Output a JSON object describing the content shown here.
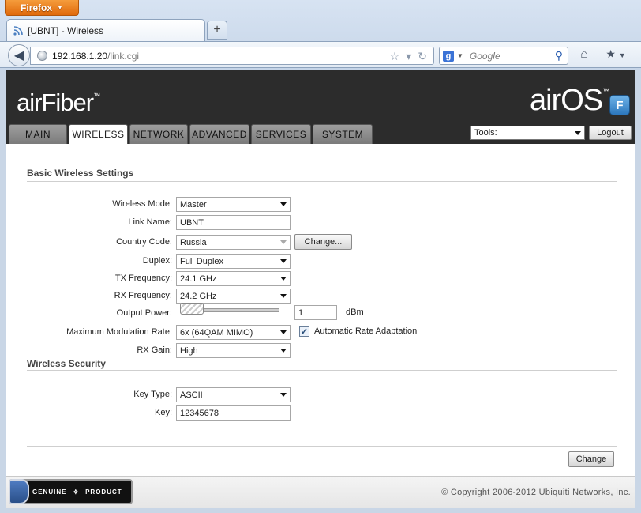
{
  "browser": {
    "menu_button": "Firefox",
    "tab_title": "[UBNT] - Wireless",
    "new_tab": "+",
    "url_host": "192.168.1.20",
    "url_path": "/link.cgi",
    "search_placeholder": "Google",
    "search_engine": "g"
  },
  "header": {
    "brand_logo": "airFiber",
    "product_logo": "airOS",
    "product_badge": "F",
    "tabs": [
      "MAIN",
      "WIRELESS",
      "NETWORK",
      "ADVANCED",
      "SERVICES",
      "SYSTEM"
    ],
    "active_tab": "WIRELESS",
    "tools_label": "Tools:",
    "logout_label": "Logout"
  },
  "basic": {
    "title": "Basic Wireless Settings",
    "wireless_mode_label": "Wireless Mode:",
    "wireless_mode": "Master",
    "link_name_label": "Link Name:",
    "link_name": "UBNT",
    "country_label": "Country Code:",
    "country": "Russia",
    "change_country": "Change...",
    "duplex_label": "Duplex:",
    "duplex": "Full Duplex",
    "tx_label": "TX Frequency:",
    "tx": "24.1 GHz",
    "rx_label": "RX Frequency:",
    "rx": "24.2 GHz",
    "power_label": "Output Power:",
    "power_value": "1",
    "power_unit": "dBm",
    "power_level": 0.0,
    "modulation_label": "Maximum Modulation Rate:",
    "modulation": "6x (64QAM MIMO)",
    "auto_rate_checked": true,
    "auto_rate_label": "Automatic Rate Adaptation",
    "rx_gain_label": "RX Gain:",
    "rx_gain": "High"
  },
  "security": {
    "title": "Wireless Security",
    "key_type_label": "Key Type:",
    "key_type": "ASCII",
    "key_label": "Key:",
    "key": "12345678"
  },
  "actions": {
    "change": "Change"
  },
  "footer": {
    "genuine_left": "GENUINE",
    "genuine_right": "PRODUCT",
    "copyright": "© Copyright 2006-2012 Ubiquiti Networks, Inc."
  },
  "colors": {
    "header_bg": "#2c2c2c",
    "firefox_orange": "#e8781a",
    "badge_blue": "#2c77bd"
  }
}
